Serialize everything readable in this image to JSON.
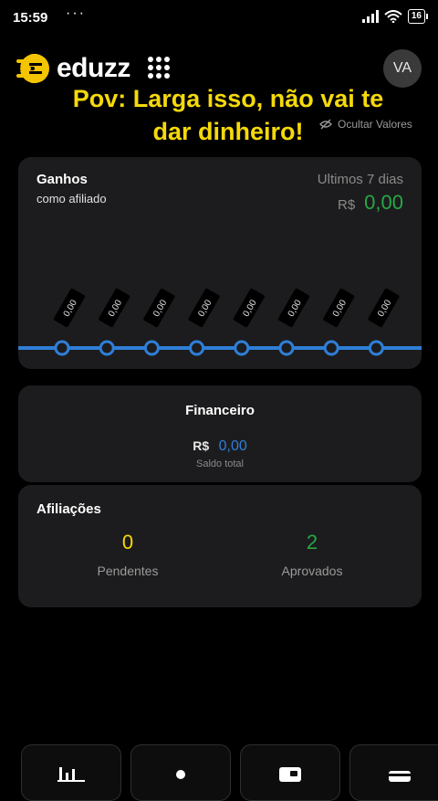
{
  "status_bar": {
    "time": "15:59",
    "dots": "···",
    "battery": "16"
  },
  "header": {
    "logo_text": "eduzz",
    "avatar_initials": "VA",
    "hide_values_label": "Ocultar Valores"
  },
  "caption": {
    "line1": "Pov: Larga isso, não vai te",
    "line2": "dar dinheiro!"
  },
  "earnings": {
    "title": "Ganhos",
    "subtitle": "como afiliado",
    "period": "Ultimos 7 dias",
    "currency": "R$",
    "value": "0,00"
  },
  "chart_data": {
    "type": "line",
    "title": "",
    "x": [
      "1",
      "2",
      "3",
      "4",
      "5",
      "6",
      "7",
      "8"
    ],
    "series": [
      {
        "values": [
          0,
          0,
          0,
          0,
          0,
          0,
          0,
          0
        ],
        "labels": [
          "0,00",
          "0,00",
          "0,00",
          "0,00",
          "0,00",
          "0,00",
          "0,00",
          "0,00"
        ]
      }
    ],
    "grid": false,
    "color": "#2f7fd8"
  },
  "finance": {
    "title": "Financeiro",
    "currency": "R$",
    "value": "0,00",
    "label": "Saldo total"
  },
  "affiliations": {
    "title": "Afiliações",
    "pending_count": "0",
    "pending_label": "Pendentes",
    "approved_count": "2",
    "approved_label": "Aprovados"
  },
  "bottom_nav": {
    "items": [
      {
        "icon": "bar-chart-icon"
      },
      {
        "icon": "dot-icon"
      },
      {
        "icon": "wallet-icon"
      },
      {
        "icon": "card-icon"
      }
    ]
  },
  "colors": {
    "accent_yellow": "#f5d90a",
    "positive_green": "#27a844",
    "link_blue": "#2f7fd8",
    "card_bg": "#1c1c1e"
  }
}
